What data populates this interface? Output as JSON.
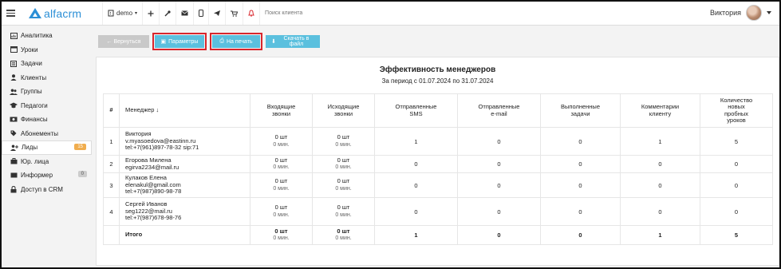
{
  "topbar": {
    "logo_text": "alfacrm",
    "school": "demo",
    "search_placeholder": "Поиск клиента",
    "user_name": "Виктория",
    "icons": [
      "plus-icon",
      "wrench-icon",
      "mail-icon",
      "phone-icon",
      "telegram-icon",
      "cart-icon",
      "bell-icon"
    ]
  },
  "sidebar": {
    "items": [
      {
        "label": "Аналитика",
        "icon": "chart-icon"
      },
      {
        "label": "Уроки",
        "icon": "window-icon"
      },
      {
        "label": "Задачи",
        "icon": "list-icon"
      },
      {
        "label": "Клиенты",
        "icon": "user-icon"
      },
      {
        "label": "Группы",
        "icon": "users-icon"
      },
      {
        "label": "Педагоги",
        "icon": "graduation-icon"
      },
      {
        "label": "Финансы",
        "icon": "money-icon"
      },
      {
        "label": "Абонементы",
        "icon": "tag-icon"
      },
      {
        "label": "Лиды",
        "icon": "user-plus-icon",
        "badge": "15"
      },
      {
        "label": "Юр. лица",
        "icon": "briefcase-icon"
      },
      {
        "label": "Информер",
        "icon": "inbox-icon",
        "badge": "0"
      },
      {
        "label": "Доступ в CRM",
        "icon": "lock-icon"
      }
    ]
  },
  "buttons": {
    "back": "← Вернуться",
    "params": "Параметры",
    "print": "На печать",
    "download": "Скачать в файл"
  },
  "report": {
    "title": "Эффективность менеджеров",
    "period": "За период с 01.07.2024 по 31.07.2024",
    "columns": {
      "num": "#",
      "manager": "Менеджер ↓",
      "incoming": [
        "Входящие",
        "звонки"
      ],
      "outgoing": [
        "Исходящие",
        "звонки"
      ],
      "sms": [
        "Отправленные",
        "SMS"
      ],
      "email": [
        "Отправленные",
        "e-mail"
      ],
      "tasks": [
        "Выполненные",
        "задачи"
      ],
      "comments": [
        "Комментарии",
        "клиенту"
      ],
      "trials": [
        "Количество",
        "новых",
        "пробных",
        "уроков"
      ]
    },
    "rows": [
      {
        "num": "1",
        "name": "Виктория",
        "email": "v.myasoedova@eastinn.ru",
        "phone": "tel:+7(961)897-78-32 sip:71",
        "in_count": "0 шт",
        "in_min": "0 мин.",
        "out_count": "0 шт",
        "out_min": "0 мин.",
        "sms": "1",
        "email_sent": "0",
        "tasks": "0",
        "comments": "1",
        "trials": "5"
      },
      {
        "num": "2",
        "name": "Егорова Милена",
        "email": "egirva2234@mail.ru",
        "phone": "",
        "in_count": "0 шт",
        "in_min": "0 мин.",
        "out_count": "0 шт",
        "out_min": "0 мин.",
        "sms": "0",
        "email_sent": "0",
        "tasks": "0",
        "comments": "0",
        "trials": "0"
      },
      {
        "num": "3",
        "name": "Кулаков Елена",
        "email": "elenakul@gmail.com",
        "phone": "tel:+7(987)890-98-78",
        "in_count": "0 шт",
        "in_min": "0 мин.",
        "out_count": "0 шт",
        "out_min": "0 мин.",
        "sms": "0",
        "email_sent": "0",
        "tasks": "0",
        "comments": "0",
        "trials": "0"
      },
      {
        "num": "4",
        "name": "Сергей Иванов",
        "email": "seg1222@mail.ru",
        "phone": "tel:+7(987)678-98-76",
        "in_count": "0 шт",
        "in_min": "0 мин.",
        "out_count": "0 шт",
        "out_min": "0 мин.",
        "sms": "0",
        "email_sent": "0",
        "tasks": "0",
        "comments": "0",
        "trials": "0"
      }
    ],
    "total": {
      "label": "Итого",
      "in_count": "0 шт",
      "in_min": "0 мин.",
      "out_count": "0 шт",
      "out_min": "0 мин.",
      "sms": "1",
      "email_sent": "0",
      "tasks": "0",
      "comments": "1",
      "trials": "5"
    }
  },
  "colors": {
    "accent": "#2b8fd6",
    "button_info": "#5bc0de",
    "button_disabled": "#c9c9c9",
    "highlight": "#d9262c",
    "badge_orange": "#f0ad4e"
  }
}
